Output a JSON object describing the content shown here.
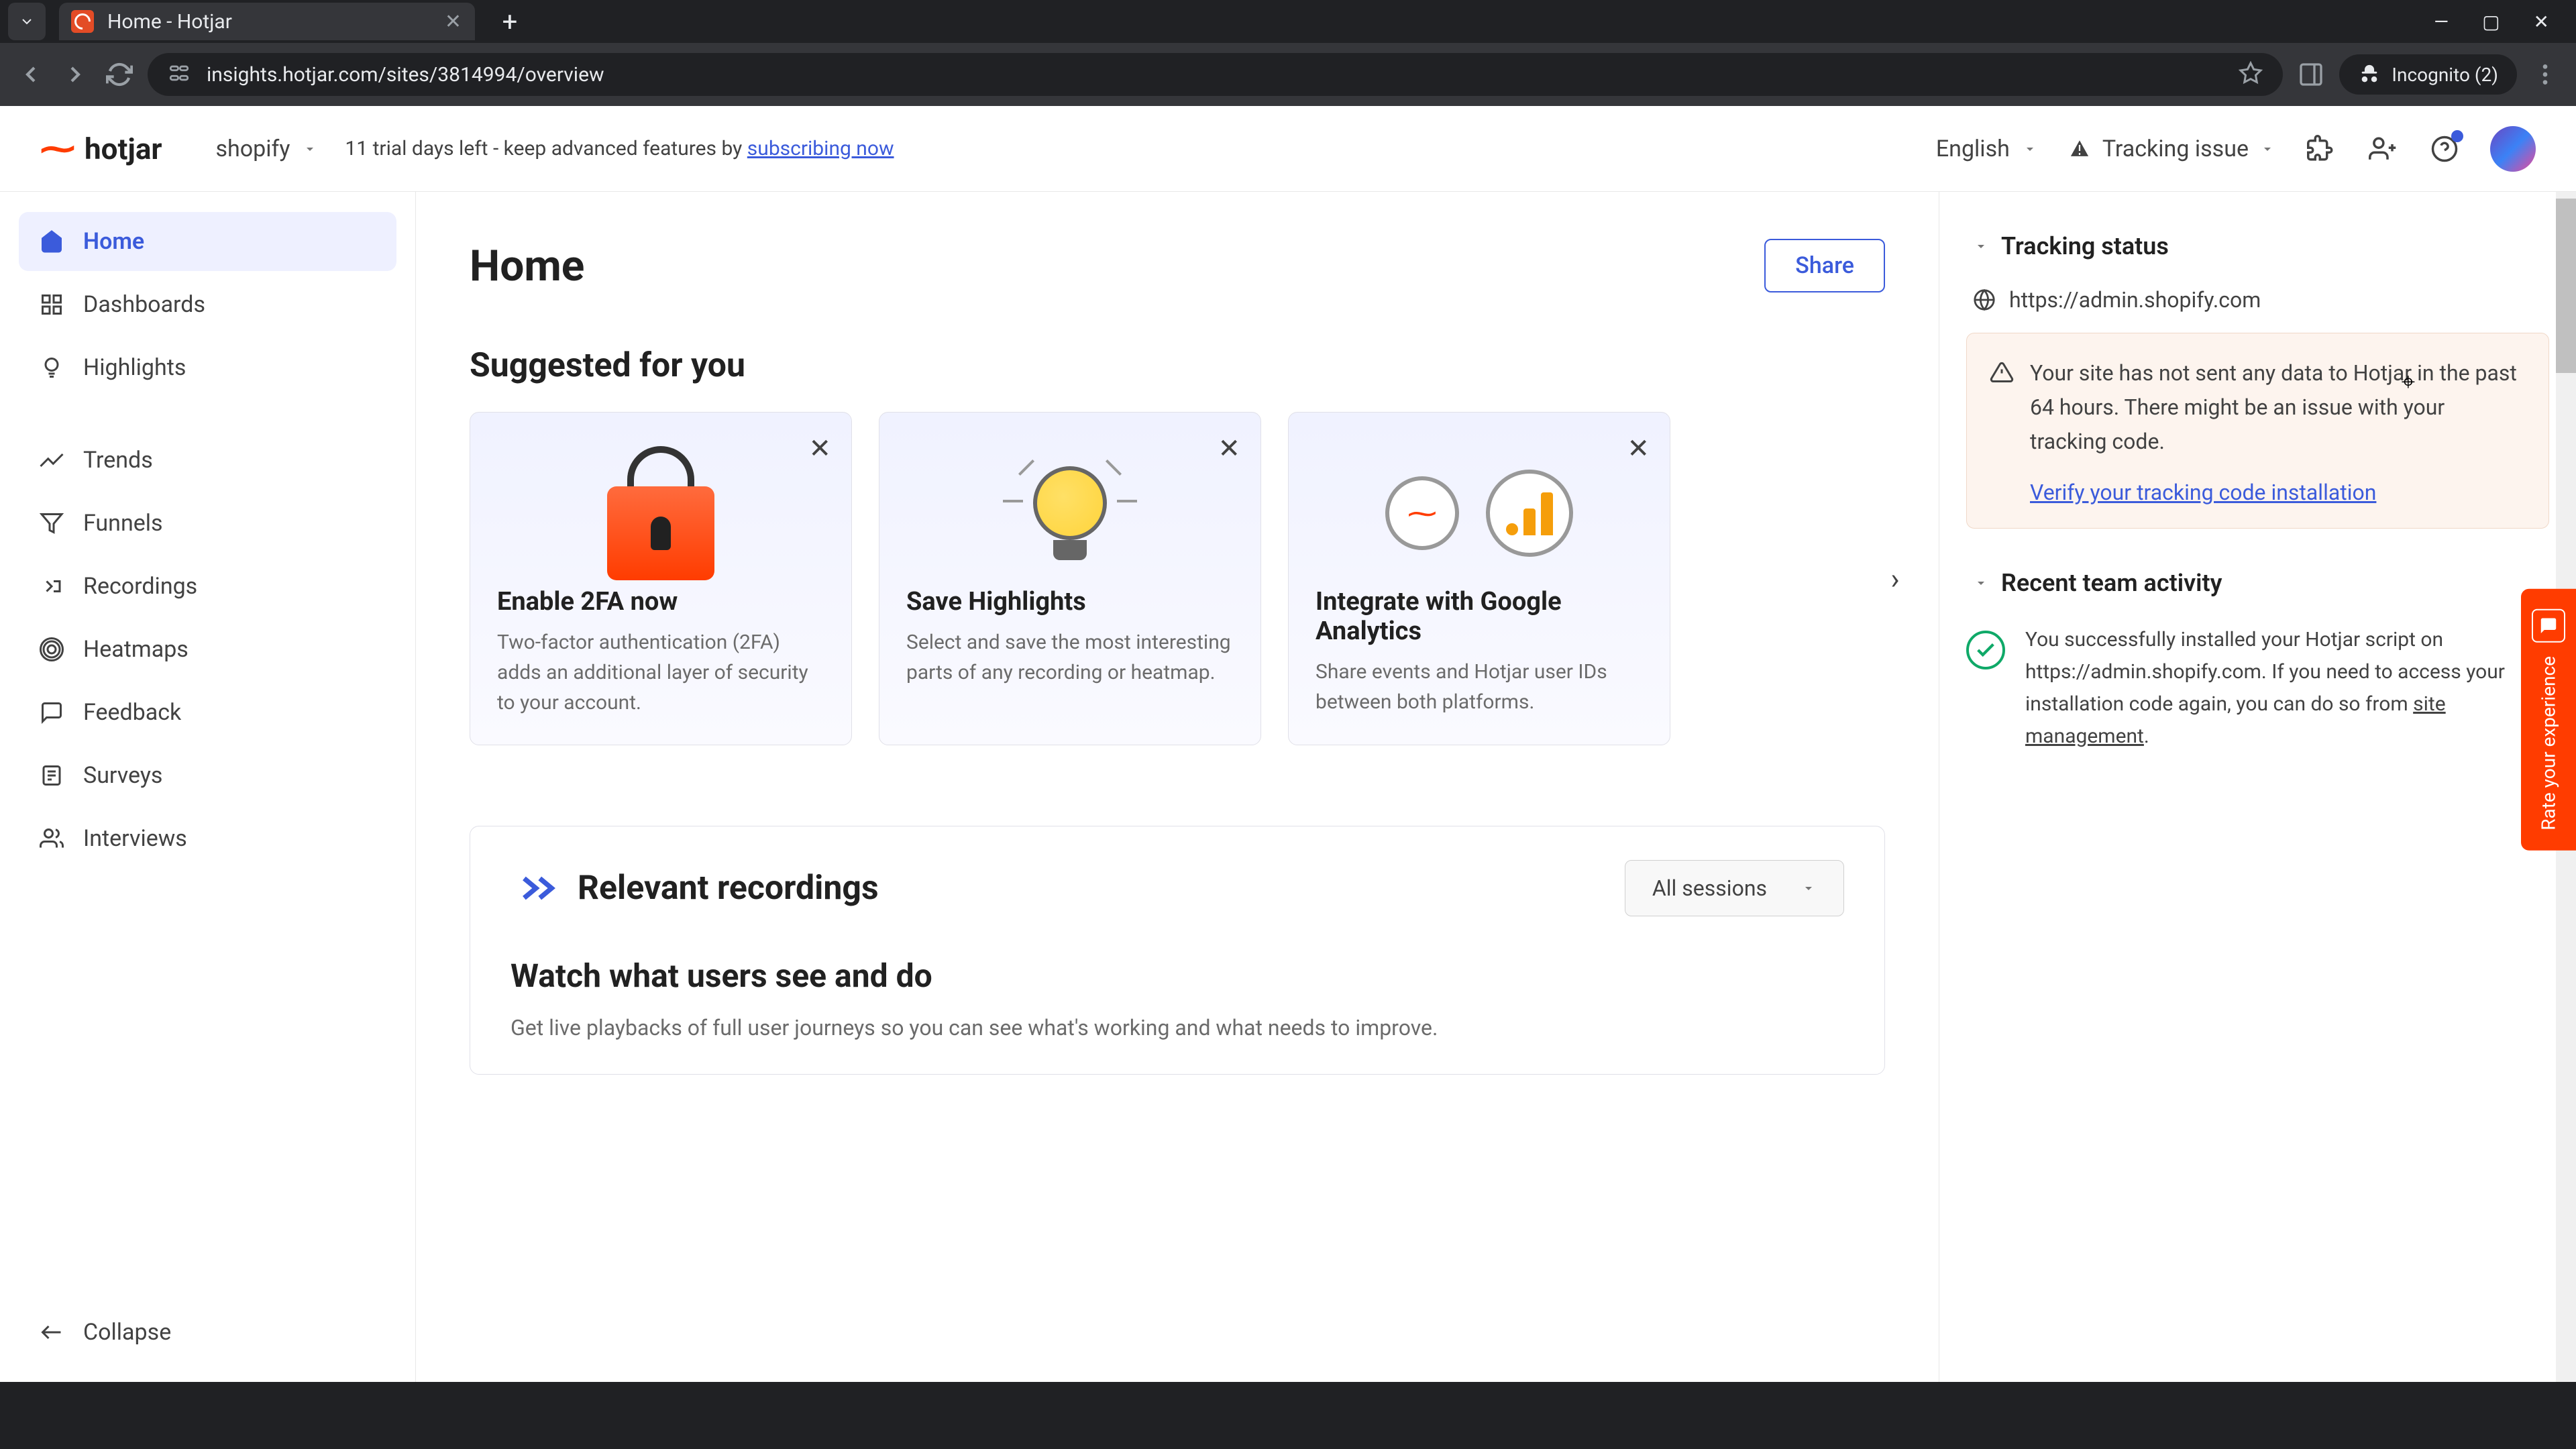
{
  "browser": {
    "tab_title": "Home - Hotjar",
    "url": "insights.hotjar.com/sites/3814994/overview",
    "incognito": "Incognito (2)"
  },
  "header": {
    "logo": "hotjar",
    "site": "shopify",
    "trial_prefix": "11 trial days left - keep advanced features by ",
    "trial_link": "subscribing now",
    "language": "English",
    "tracking": "Tracking issue"
  },
  "sidebar": {
    "items": [
      {
        "label": "Home"
      },
      {
        "label": "Dashboards"
      },
      {
        "label": "Highlights"
      },
      {
        "label": "Trends"
      },
      {
        "label": "Funnels"
      },
      {
        "label": "Recordings"
      },
      {
        "label": "Heatmaps"
      },
      {
        "label": "Feedback"
      },
      {
        "label": "Surveys"
      },
      {
        "label": "Interviews"
      }
    ],
    "collapse": "Collapse"
  },
  "page": {
    "title": "Home",
    "share": "Share",
    "suggested": "Suggested for you",
    "cards": [
      {
        "title": "Enable 2FA now",
        "desc": "Two-factor authentication (2FA) adds an additional layer of security to your account."
      },
      {
        "title": "Save Highlights",
        "desc": "Select and save the most interesting parts of any recording or heatmap."
      },
      {
        "title": "Integrate with Google Analytics",
        "desc": "Share events and Hotjar user IDs between both platforms."
      }
    ],
    "recordings": {
      "title": "Relevant recordings",
      "filter": "All sessions",
      "subtitle": "Watch what users see and do",
      "desc": "Get live playbacks of full user journeys so you can see what's working and what needs to improve."
    }
  },
  "tracking_panel": {
    "title": "Tracking status",
    "url": "https://admin.shopify.com",
    "warning": "Your site has not sent any data to Hotjar in the past 64 hours. There might be an issue with your tracking code.",
    "verify": "Verify your tracking code installation"
  },
  "activity_panel": {
    "title": "Recent team activity",
    "text_prefix": "You successfully installed your Hotjar script on https://admin.shopify.com. If you need to access your installation code again, you can do so from ",
    "link": "site management",
    "suffix": "."
  },
  "feedback_tab": "Rate your experience"
}
